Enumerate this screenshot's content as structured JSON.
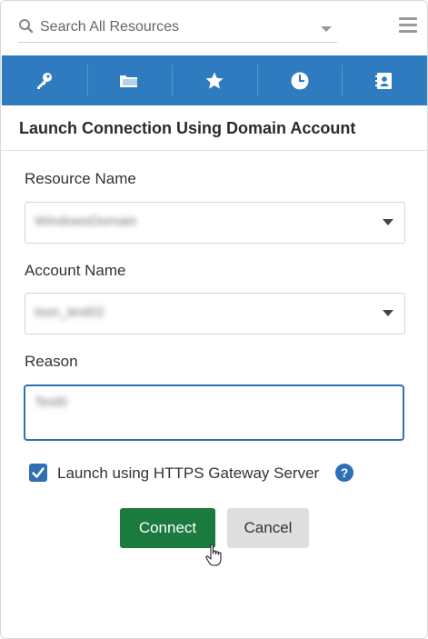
{
  "search": {
    "placeholder": "Search All Resources"
  },
  "toolbar": {
    "icons": [
      "key-icon",
      "folder-icon",
      "star-icon",
      "clock-icon",
      "contact-card-icon"
    ]
  },
  "dialog": {
    "title": "Launch Connection Using Domain Account",
    "resource": {
      "label": "Resource Name",
      "value": "WindowsDomain"
    },
    "account": {
      "label": "Account Name",
      "value": "ison_test02"
    },
    "reason": {
      "label": "Reason",
      "value": "Test0"
    },
    "gateway": {
      "label": "Launch using HTTPS Gateway Server",
      "checked": true,
      "help": "?"
    },
    "buttons": {
      "connect": "Connect",
      "cancel": "Cancel"
    }
  },
  "colors": {
    "toolbar": "#2f7bbf",
    "accent": "#2f6fb5",
    "connect": "#1b7a3e",
    "cancel": "#dedede"
  }
}
